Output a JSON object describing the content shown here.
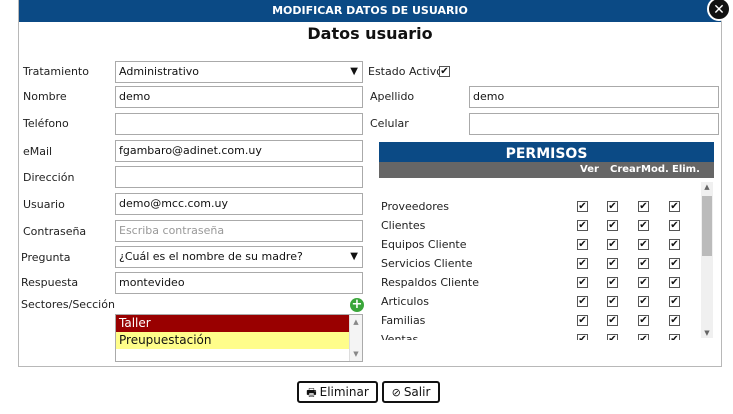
{
  "dialog": {
    "title": "MODIFICAR DATOS DE USUARIO",
    "section_title": "Datos usuario",
    "close_icon": "✕"
  },
  "form": {
    "tratamiento": {
      "label": "Tratamiento",
      "value": "Administrativo"
    },
    "estado_activo": {
      "label": "Estado Activo",
      "checked": true
    },
    "nombre": {
      "label": "Nombre",
      "value": "demo"
    },
    "apellido": {
      "label": "Apellido",
      "value": "demo"
    },
    "telefono": {
      "label": "Teléfono",
      "value": ""
    },
    "celular": {
      "label": "Celular",
      "value": ""
    },
    "email": {
      "label": "eMail",
      "value": "fgambaro@adinet.com.uy"
    },
    "direccion": {
      "label": "Dirección",
      "value": ""
    },
    "usuario": {
      "label": "Usuario",
      "value": "demo@mcc.com.uy"
    },
    "contrasena": {
      "label": "Contraseña",
      "placeholder": "Escriba contraseña"
    },
    "pregunta": {
      "label": "Pregunta",
      "value": "¿Cuál es el nombre de su madre?"
    },
    "respuesta": {
      "label": "Respuesta",
      "value": "montevideo"
    },
    "sectores": {
      "label": "Sectores/Sección",
      "options": [
        {
          "label": "Taller",
          "color": "#990000"
        },
        {
          "label": "Preupuestación",
          "color": "#fffd8a"
        }
      ]
    }
  },
  "permisos": {
    "title": "PERMISOS",
    "columns": [
      "Ver",
      "Crear",
      "Mod.",
      "Elim."
    ],
    "rows": [
      {
        "name": "Proveedores"
      },
      {
        "name": "Clientes"
      },
      {
        "name": "Equipos Cliente"
      },
      {
        "name": "Servicios Cliente"
      },
      {
        "name": "Respaldos Cliente"
      },
      {
        "name": "Articulos"
      },
      {
        "name": "Familias"
      },
      {
        "name": "Ventas"
      }
    ]
  },
  "actions": {
    "eliminar": {
      "label": "Eliminar",
      "icon": "printer-icon"
    },
    "salir": {
      "label": "Salir",
      "icon": "cancel-icon"
    }
  },
  "colors": {
    "header_blue": "#0b4a85",
    "column_gray": "#666666"
  }
}
